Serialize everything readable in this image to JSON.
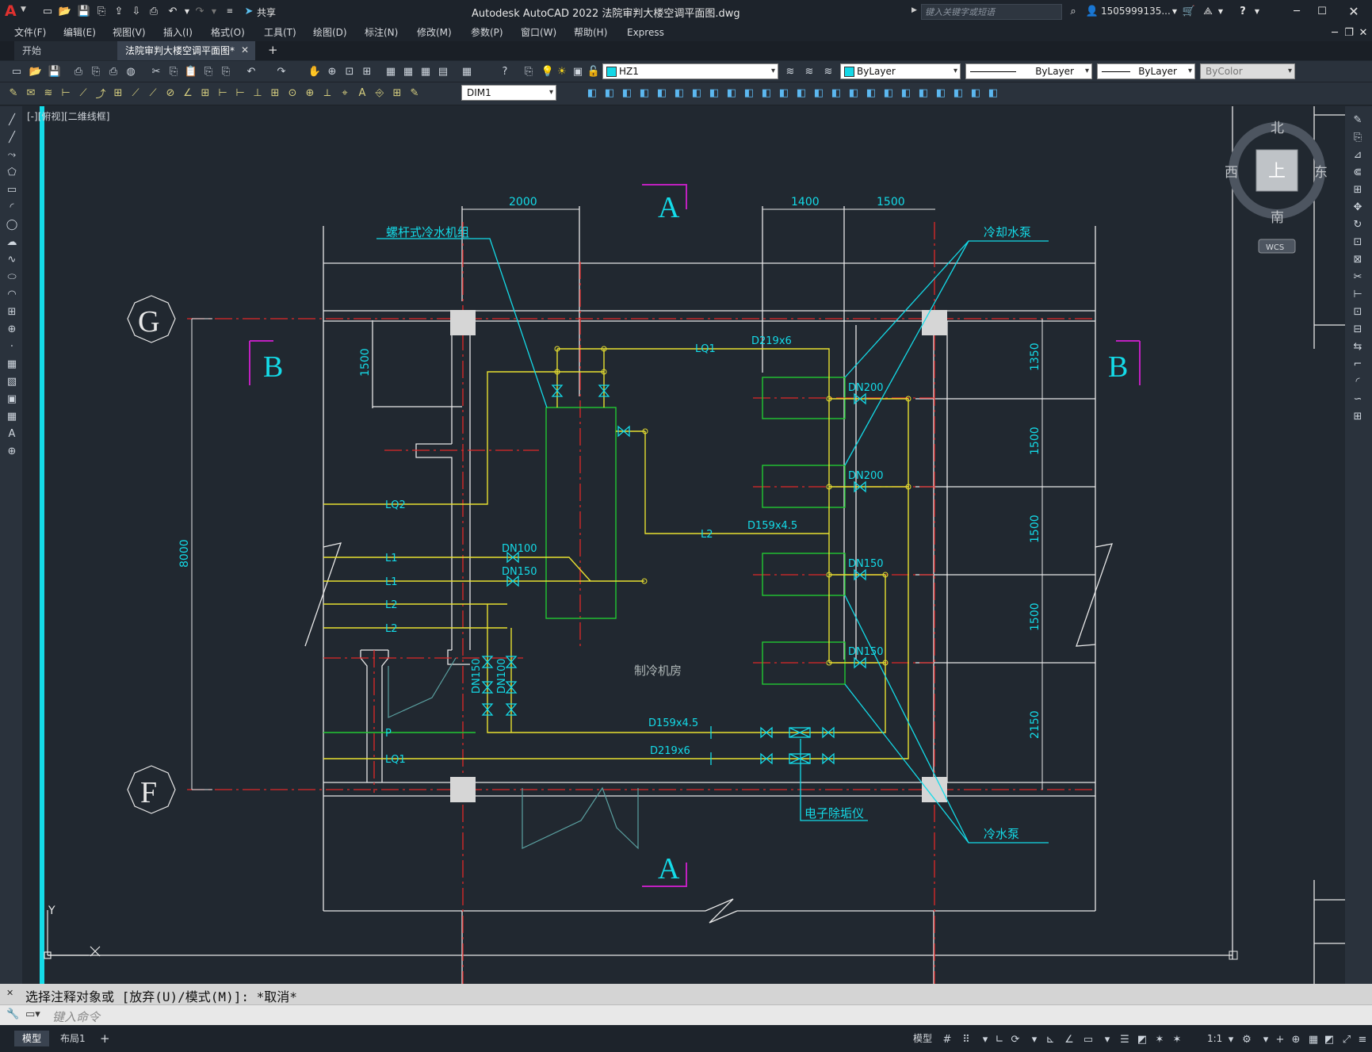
{
  "app": {
    "title": "Autodesk AutoCAD 2022    法院审判大楼空调平面图.dwg",
    "share_label": "共享",
    "search_placeholder": "键入关键字或短语",
    "user": "1505999135...",
    "help": "?",
    "logo": "A"
  },
  "menu": [
    "文件(F)",
    "编辑(E)",
    "视图(V)",
    "插入(I)",
    "格式(O)",
    "工具(T)",
    "绘图(D)",
    "标注(N)",
    "修改(M)",
    "参数(P)",
    "窗口(W)",
    "帮助(H)",
    "Express"
  ],
  "tabs": {
    "start": "开始",
    "drawing": "法院审判大楼空调平面图*",
    "add": "+"
  },
  "toolbar": {
    "layer": "HZ1",
    "color": "ByLayer",
    "linetype": "ByLayer",
    "lineweight": "ByLayer",
    "plotstyle": "ByColor",
    "dimstyle": "DIM1"
  },
  "viewport": {
    "label": "[-][俯视][二维线框]",
    "ucs_y": "Y",
    "ucs_x": "X"
  },
  "viewcube": {
    "north": "北",
    "south": "南",
    "west": "西",
    "east": "东",
    "face": "上",
    "wcs": "WCS"
  },
  "drawing": {
    "dims": {
      "d2000": "2000",
      "d1400": "1400",
      "d1500a": "1500",
      "d1500v": "1500",
      "d8000": "8000",
      "d1350": "1350",
      "d1500r1": "1500",
      "d1500r2": "1500",
      "d1500r3": "1500",
      "d2150": "2150"
    },
    "axis_g": "G",
    "axis_f": "F",
    "sec_a_top": "A",
    "sec_a_bot": "A",
    "sec_b_left": "B",
    "sec_b_right": "B",
    "chiller": "螺杆式冷水机组",
    "cooling_pump": "冷却水泵",
    "chilled_pump": "冷水泵",
    "descaler": "电子除垢仪",
    "room": "制冷机房",
    "pipes": {
      "lq1_top": "LQ1",
      "d219_top": "D219x6",
      "lq2": "LQ2",
      "l1a": "L1",
      "l1b": "L1",
      "l2a": "L2",
      "l2b": "L2",
      "l2mid": "L2",
      "d159_mid": "D159x4.5",
      "p": "P",
      "lq1_bot": "LQ1",
      "d159_bot": "D159x4.5",
      "d219_bot": "D219x6"
    },
    "valves": {
      "dn100": "DN100",
      "dn150": "DN150",
      "dn200a": "DN200",
      "dn200b": "DN200",
      "dn150a": "DN150",
      "dn150b": "DN150",
      "dn150v": "DN150",
      "dn100v": "DN100"
    }
  },
  "command": {
    "history": "选择注释对象或 [放弃(U)/模式(M)]: *取消*",
    "placeholder": "键入命令"
  },
  "status": {
    "model": "模型",
    "layout": "布局1",
    "add": "+",
    "model_btn": "模型",
    "scale": "1:1"
  }
}
